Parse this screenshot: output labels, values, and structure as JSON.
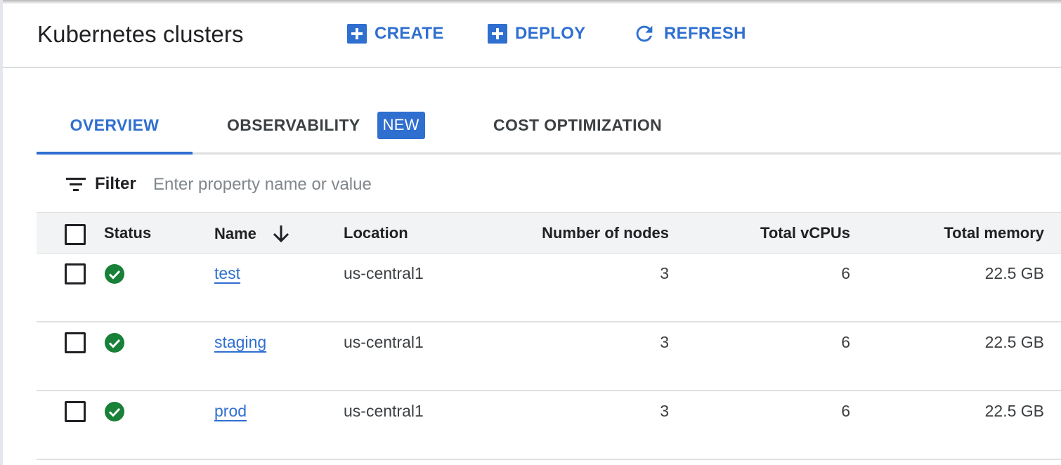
{
  "header": {
    "title": "Kubernetes clusters",
    "actions": [
      {
        "label": "CREATE",
        "icon": "add-box-icon"
      },
      {
        "label": "DEPLOY",
        "icon": "add-box-icon"
      },
      {
        "label": "REFRESH",
        "icon": "refresh-icon"
      }
    ]
  },
  "tabs": [
    {
      "label": "OVERVIEW",
      "active": true
    },
    {
      "label": "OBSERVABILITY",
      "badge": "NEW"
    },
    {
      "label": "COST OPTIMIZATION"
    }
  ],
  "filter": {
    "label": "Filter",
    "placeholder": "Enter property name or value",
    "icon": "filter-list-icon"
  },
  "table": {
    "columns": {
      "status": "Status",
      "name": "Name",
      "location": "Location",
      "nodes": "Number of nodes",
      "vcpus": "Total vCPUs",
      "memory": "Total memory"
    },
    "sort_icon": "arrow-down-icon",
    "rows": [
      {
        "status": "ok",
        "name": "test",
        "location": "us-central1",
        "nodes": "3",
        "vcpus": "6",
        "memory": "22.5 GB"
      },
      {
        "status": "ok",
        "name": "staging",
        "location": "us-central1",
        "nodes": "3",
        "vcpus": "6",
        "memory": "22.5 GB"
      },
      {
        "status": "ok",
        "name": "prod",
        "location": "us-central1",
        "nodes": "3",
        "vcpus": "6",
        "memory": "22.5 GB"
      }
    ]
  },
  "colors": {
    "accent": "#2f6fd0",
    "status_ok": "#188038",
    "header_bg": "#f1f3f4"
  }
}
